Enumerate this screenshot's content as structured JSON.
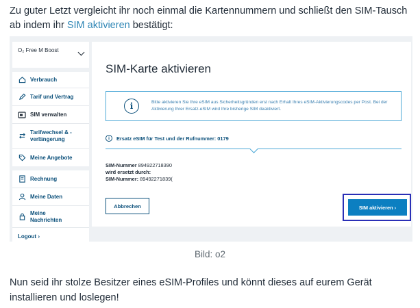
{
  "intro": {
    "text_before": "Zu guter Letzt vergleicht ihr noch einmal die Kartennummern und schließt den SIM-Tausch ab indem ihr ",
    "link": "SIM aktivieren",
    "text_after": " bestätigt:"
  },
  "sidebar": {
    "contract": "O₂ Free M Boost",
    "items": [
      {
        "label": "Verbrauch",
        "icon": "home-icon"
      },
      {
        "label": "Tarif und Vertrag",
        "icon": "pen-icon"
      },
      {
        "label": "SIM verwalten",
        "icon": "sim-card-icon"
      },
      {
        "label": "Tarifwechsel & -verlängerung",
        "icon": "swap-icon"
      },
      {
        "label": "Meine Angebote",
        "icon": "tag-icon"
      },
      {
        "label": "Rechnung",
        "icon": "invoice-icon"
      },
      {
        "label": "Meine Daten",
        "icon": "user-icon"
      },
      {
        "label": "Meine Nachrichten",
        "icon": "lock-icon"
      }
    ],
    "logout": "Logout ›"
  },
  "card": {
    "title": "SIM-Karte aktivieren",
    "info_text": "Bitte aktivieren Sie Ihre eSIM aus Sicherheitsgründen erst nach Erhalt Ihres eSIM-Aktivierungscodes per Post. Bei der Aktivierung Ihrer Ersatz-eSIM wird Ihre bisherige SIM deaktiviert.",
    "esim_label": "Ersatz eSIM für Test und der Rufnummer: 0179",
    "sim_label1": "SIM-Nummer",
    "sim_value1": "894922718390",
    "replaced_by": "wird ersetzt durch:",
    "sim_label2": "SIM-Nummer:",
    "sim_value2": "89492271839(",
    "cancel": "Abbrechen",
    "activate": "SIM aktivieren ›"
  },
  "caption": "Bild: o2",
  "outro": "Nun seid ihr stolze Besitzer eines eSIM-Profiles und könnt dieses auf eurem Gerät installieren und loslegen!"
}
